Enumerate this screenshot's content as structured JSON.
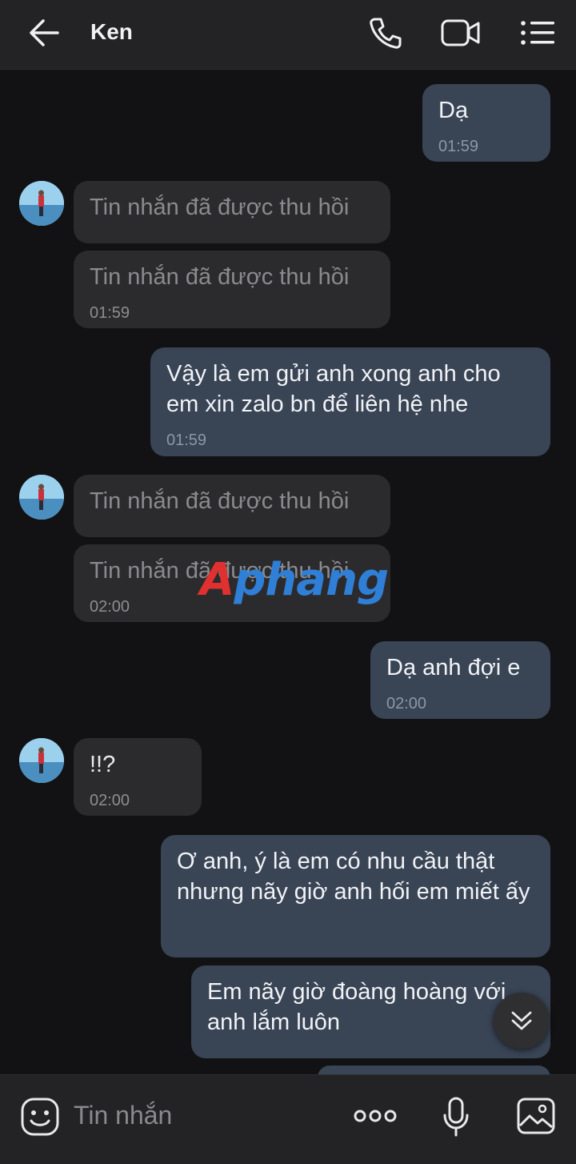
{
  "header": {
    "back_icon": "arrow-left-icon",
    "title": "Ken",
    "call_icon": "phone-icon",
    "video_icon": "video-camera-icon",
    "menu_icon": "list-menu-icon"
  },
  "messages": [
    {
      "sender": "me",
      "text": "Dạ",
      "time": "01:59"
    },
    {
      "sender": "Ken",
      "text": "Tin nhắn đã được thu hồi",
      "recalled": true
    },
    {
      "sender": "Ken",
      "text": "Tin nhắn đã được thu hồi",
      "recalled": true,
      "time": "01:59"
    },
    {
      "sender": "me",
      "text": "Vậy là em gửi anh xong anh cho em xin zalo bn để liên hệ nhe",
      "time": "01:59"
    },
    {
      "sender": "Ken",
      "text": "Tin nhắn đã được thu hồi",
      "recalled": true
    },
    {
      "sender": "Ken",
      "text": "Tin nhắn đã được thu hồi",
      "recalled": true,
      "time": "02:00"
    },
    {
      "sender": "me",
      "text": "Dạ anh đợi e",
      "time": "02:00"
    },
    {
      "sender": "Ken",
      "text": "!!?",
      "time": "02:00"
    },
    {
      "sender": "me",
      "text": "Ơ anh, ý là em có nhu cầu thật nhưng nãy giờ anh hối em miết ấy"
    },
    {
      "sender": "me",
      "text": "Em nãy giờ đoàng hoàng với anh lắm luôn"
    }
  ],
  "watermark": {
    "first": "A",
    "rest": "phang"
  },
  "scroll_down_icon": "double-chevron-down-icon",
  "composer": {
    "emoji_icon": "emoji-icon",
    "placeholder": "Tin nhắn",
    "more_icon": "more-dots-icon",
    "mic_icon": "microphone-icon",
    "image_icon": "image-icon"
  },
  "colors": {
    "my_bubble": "#394455",
    "their_bubble": "#2b2b2d",
    "background": "#121214"
  }
}
